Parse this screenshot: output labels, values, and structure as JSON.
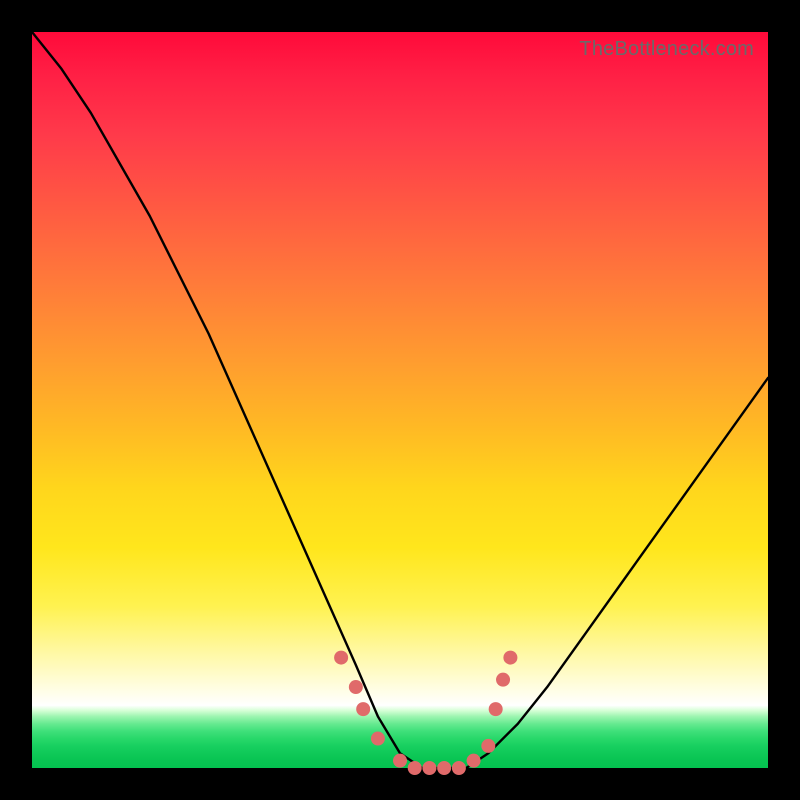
{
  "watermark": {
    "text": "TheBottleneck.com"
  },
  "colors": {
    "frame": "#000000",
    "curve": "#000000",
    "markers": "#e06a6a",
    "marker_stroke": "#d85858"
  },
  "chart_data": {
    "type": "line",
    "title": "",
    "xlabel": "",
    "ylabel": "",
    "xlim": [
      0,
      100
    ],
    "ylim": [
      0,
      100
    ],
    "legend_position": "none",
    "grid": false,
    "description": "V-shaped bottleneck curve over vertical color gradient. Green band near y≈0–7, white/pale ≈7–10, yellow ≈10–45, orange ≈45–75, red ≈75–100.",
    "series": [
      {
        "name": "bottleneck-curve",
        "x": [
          0,
          4,
          8,
          12,
          16,
          20,
          24,
          28,
          32,
          36,
          40,
          44,
          47,
          50,
          53,
          56,
          59,
          62,
          66,
          70,
          75,
          80,
          85,
          90,
          95,
          100
        ],
        "y": [
          100,
          95,
          89,
          82,
          75,
          67,
          59,
          50,
          41,
          32,
          23,
          14,
          7,
          2,
          0,
          0,
          0,
          2,
          6,
          11,
          18,
          25,
          32,
          39,
          46,
          53
        ]
      }
    ],
    "markers": {
      "name": "highlighted-points",
      "note": "salmon dots near the trough of the curve",
      "points": [
        {
          "x": 42,
          "y": 15
        },
        {
          "x": 44,
          "y": 11
        },
        {
          "x": 45,
          "y": 8
        },
        {
          "x": 47,
          "y": 4
        },
        {
          "x": 50,
          "y": 1
        },
        {
          "x": 52,
          "y": 0
        },
        {
          "x": 54,
          "y": 0
        },
        {
          "x": 56,
          "y": 0
        },
        {
          "x": 58,
          "y": 0
        },
        {
          "x": 60,
          "y": 1
        },
        {
          "x": 62,
          "y": 3
        },
        {
          "x": 63,
          "y": 8
        },
        {
          "x": 64,
          "y": 12
        },
        {
          "x": 65,
          "y": 15
        }
      ]
    }
  }
}
